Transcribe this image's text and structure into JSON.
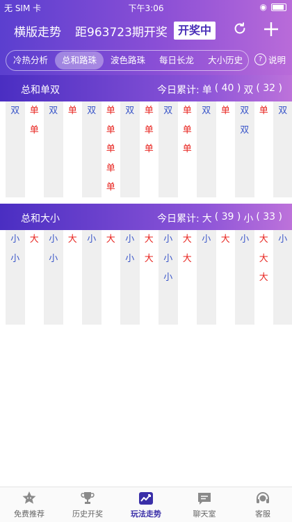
{
  "status_bar": {
    "carrier": "无 SIM 卡",
    "time": "下午3:06"
  },
  "nav": {
    "title": "横版走势",
    "period_text": "距963723期开奖",
    "badge": "开奖中"
  },
  "tabs": [
    {
      "label": "冷热分析",
      "active": false
    },
    {
      "label": "总和路珠",
      "active": true
    },
    {
      "label": "波色路珠",
      "active": false
    },
    {
      "label": "每日长龙",
      "active": false
    },
    {
      "label": "大小历史",
      "active": false
    }
  ],
  "help_label": "说明",
  "odd_even": {
    "title": "总和单双",
    "summary_prefix": "今日累计:",
    "a_label": "单",
    "a_count": "( 40 )",
    "b_label": "双",
    "b_count": "( 32 )",
    "columns": [
      [
        "双"
      ],
      [
        "单",
        "单"
      ],
      [
        "双"
      ],
      [
        "单"
      ],
      [
        "双"
      ],
      [
        "单",
        "单",
        "单",
        "单",
        "单"
      ],
      [
        "双"
      ],
      [
        "单",
        "单",
        "单"
      ],
      [
        "双"
      ],
      [
        "单",
        "单",
        "单"
      ],
      [
        "双"
      ],
      [
        "单"
      ],
      [
        "双",
        "双"
      ],
      [
        "单"
      ],
      [
        "双"
      ]
    ]
  },
  "big_small": {
    "title": "总和大小",
    "summary_prefix": "今日累计:",
    "a_label": "大",
    "a_count": "( 39 )",
    "b_label": "小",
    "b_count": "( 33 )",
    "columns": [
      [
        "小",
        "小"
      ],
      [
        "大"
      ],
      [
        "小",
        "小"
      ],
      [
        "大"
      ],
      [
        "小"
      ],
      [
        "大"
      ],
      [
        "小",
        "小"
      ],
      [
        "大",
        "大"
      ],
      [
        "小",
        "小",
        "小"
      ],
      [
        "大",
        "大"
      ],
      [
        "小"
      ],
      [
        "大"
      ],
      [
        "小"
      ],
      [
        "大",
        "大",
        "大"
      ],
      [
        "小"
      ]
    ]
  },
  "colors": {
    "red": "#e8231e",
    "blue": "#3a56c9",
    "accent": "#5b3fcf"
  },
  "bottom_tabs": [
    {
      "label": "免费推荐",
      "icon": "star-face-icon",
      "active": false
    },
    {
      "label": "历史开奖",
      "icon": "trophy-icon",
      "active": false
    },
    {
      "label": "玩法走势",
      "icon": "trend-chart-icon",
      "active": true
    },
    {
      "label": "聊天室",
      "icon": "chat-icon",
      "active": false
    },
    {
      "label": "客服",
      "icon": "headset-icon",
      "active": false
    }
  ]
}
